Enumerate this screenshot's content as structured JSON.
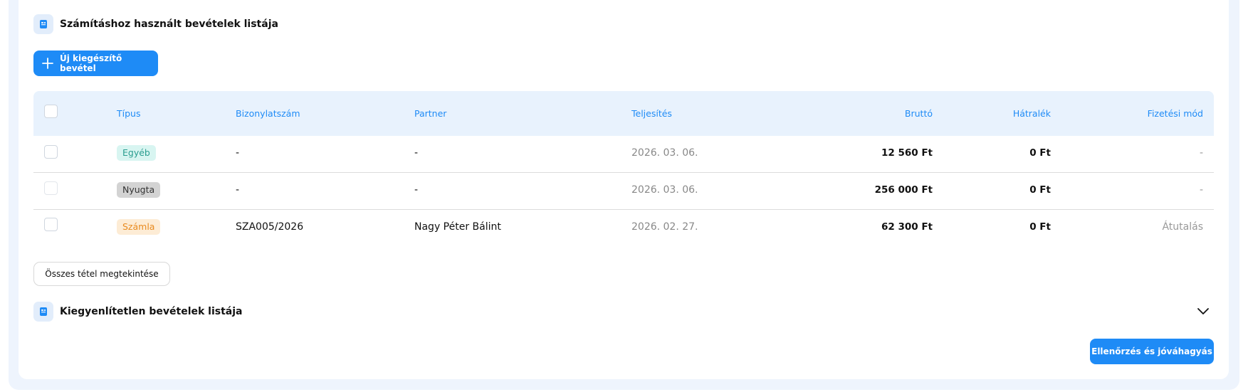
{
  "sections": {
    "used_income": {
      "title": "Számításhoz használt bevételek listája",
      "icon": "receipt-icon"
    },
    "unsettled_income": {
      "title": "Kiegyenlítetlen bevételek listája",
      "icon": "receipt-icon",
      "toggle_icon": "chevron-down-icon"
    }
  },
  "buttons": {
    "new_income": "Új kiegészítő bevétel",
    "view_all": "Összes tétel megtekintése",
    "verify_approve": "Ellenőrzés és jóváhagyás"
  },
  "table": {
    "headers": {
      "type": "Típus",
      "doc_number": "Bizonylatszám",
      "partner": "Partner",
      "fulfillment": "Teljesítés",
      "gross": "Bruttó",
      "arrears": "Hátralék",
      "payment_method": "Fizetési mód"
    },
    "rows": [
      {
        "type": "Egyéb",
        "doc_number": "-",
        "partner": "-",
        "fulfillment": "2026. 03. 06.",
        "gross": "12 560 Ft",
        "arrears": "0 Ft",
        "payment_method": "-"
      },
      {
        "type": "Nyugta",
        "doc_number": "-",
        "partner": "-",
        "fulfillment": "2026. 03. 06.",
        "gross": "256 000 Ft",
        "arrears": "0 Ft",
        "payment_method": "-"
      },
      {
        "type": "Számla",
        "doc_number": "SZA005/2026",
        "partner": "Nagy Péter Bálint",
        "fulfillment": "2026. 02. 27.",
        "gross": "62 300 Ft",
        "arrears": "0 Ft",
        "payment_method": "Átutalás"
      }
    ]
  },
  "colors": {
    "accent": "#1e8bf6",
    "header_bg": "#e8f2fd",
    "badge_egyeb": "#d8f5f1",
    "badge_nyugta": "#d3d3d3",
    "badge_szamla": "#fdecd5"
  }
}
